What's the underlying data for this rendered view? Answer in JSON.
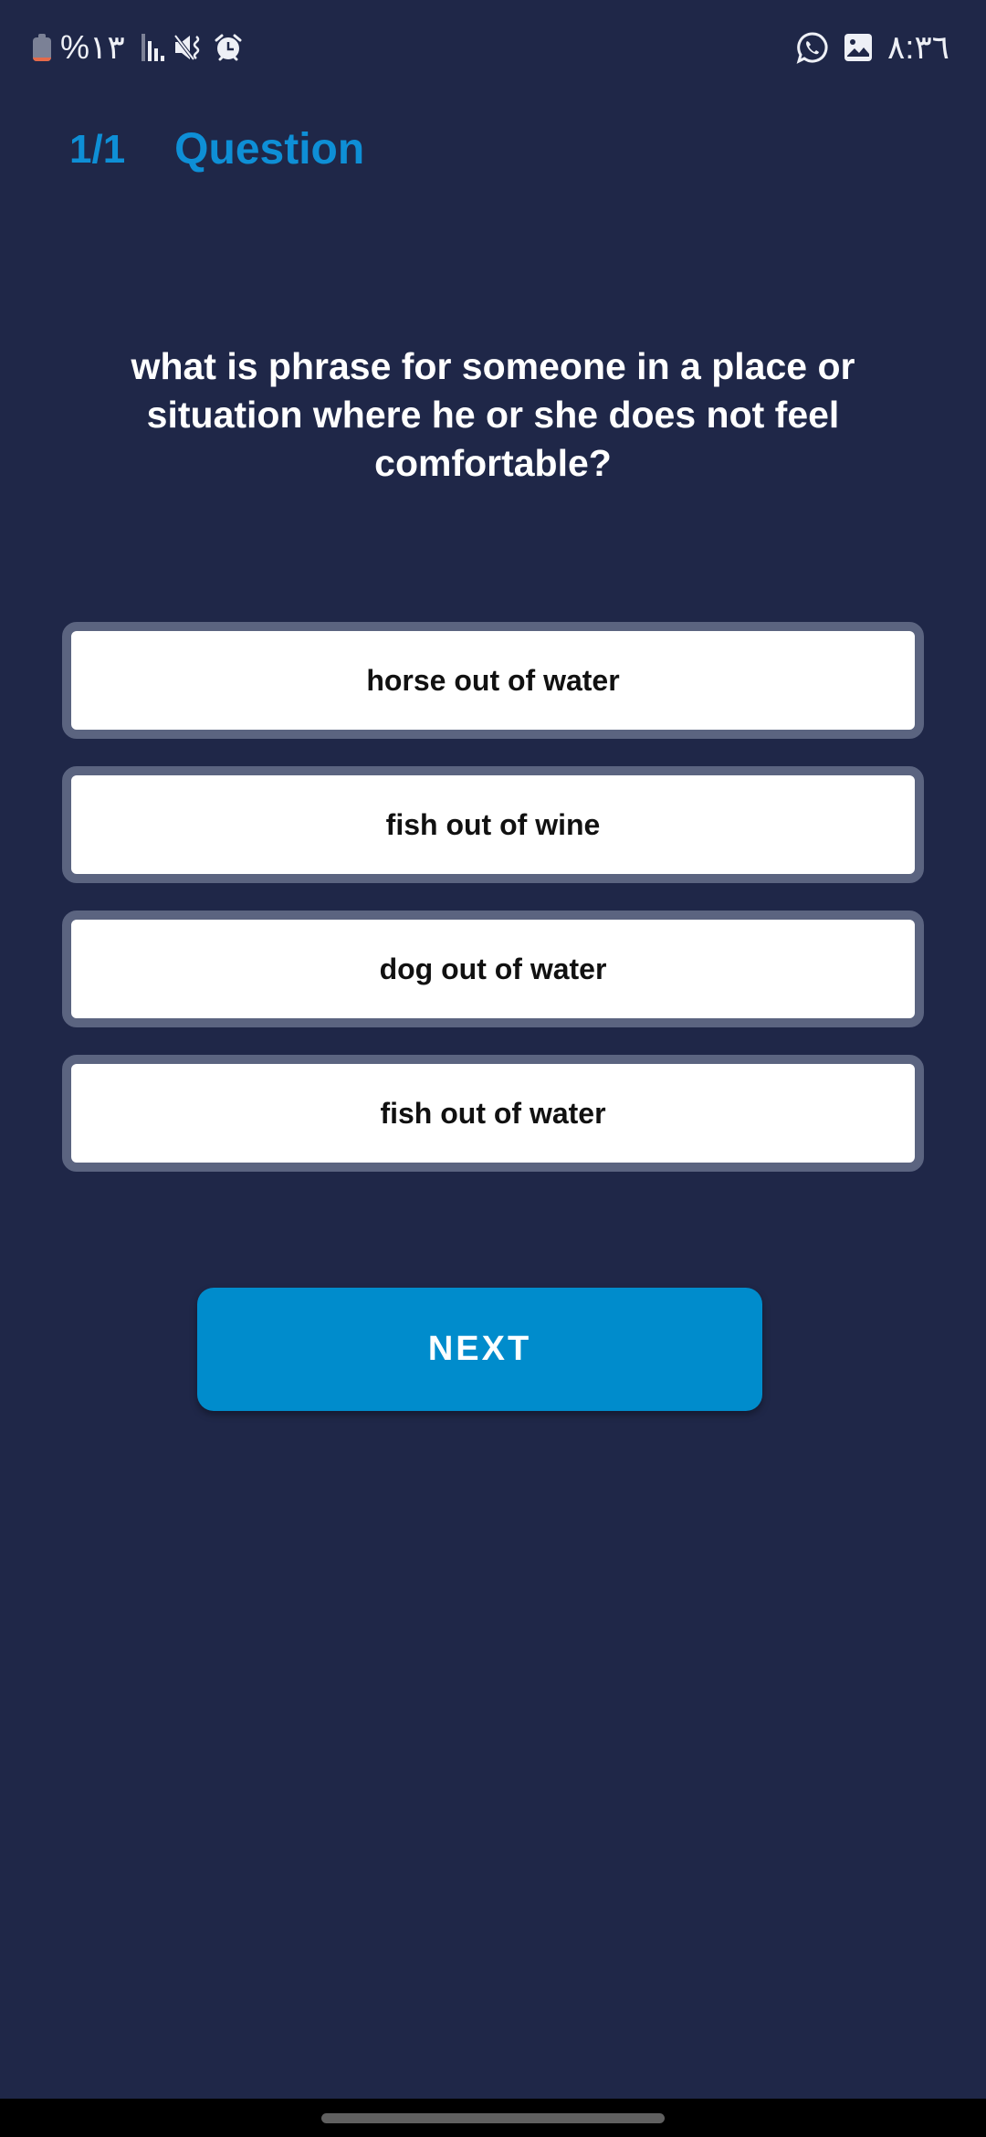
{
  "status_bar": {
    "battery_text": "%١٣",
    "time": "٨:٣٦",
    "left_icons": [
      "battery-icon",
      "signal-icon",
      "mute-icon",
      "alarm-icon"
    ],
    "right_icons": [
      "whatsapp-icon",
      "gallery-icon"
    ],
    "battery_level_color": "#e56a4a"
  },
  "header": {
    "counter": "1/1",
    "title": "Question"
  },
  "question": {
    "text": "what is phrase for someone in a place or situation where he or she does not feel comfortable?"
  },
  "answers": [
    {
      "label": "horse out of water"
    },
    {
      "label": "fish out of wine"
    },
    {
      "label": "dog out of water"
    },
    {
      "label": "fish out of water"
    }
  ],
  "next_button": {
    "label": "NEXT"
  },
  "colors": {
    "background": "#1f2748",
    "accent": "#0e8fd6",
    "button": "#008ccc",
    "answer_border": "#5b6480"
  }
}
